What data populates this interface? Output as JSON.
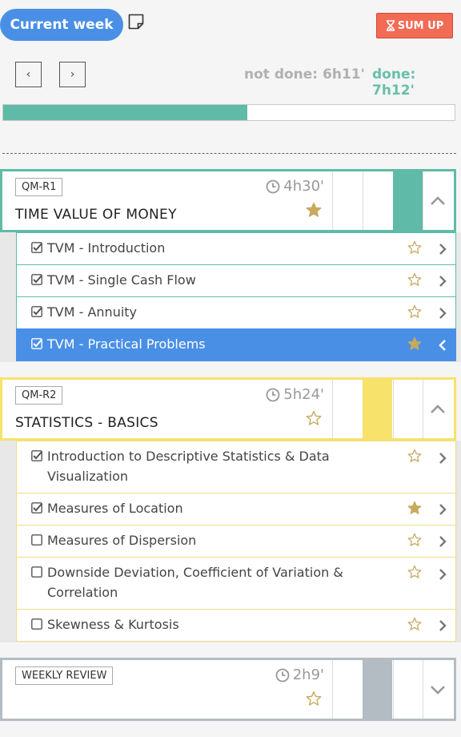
{
  "header": {
    "week_label": "Current week",
    "sum_up_label": "SUM UP",
    "prev_label": "‹",
    "next_label": "›",
    "not_done_label": "not done: 6h11'",
    "done_label": "done: 7h12'",
    "progress_fraction": 0.54
  },
  "colors": {
    "accent": "#4a8fe6",
    "done": "#68bfa8",
    "section1": "#5fbba7",
    "section2": "#f7e26b",
    "section3": "#b3bcc2",
    "sumup": "#f26b55"
  },
  "sections": [
    {
      "code": "QM-R1",
      "title": "TIME VALUE OF MONEY",
      "time": "4h30'",
      "starred": true,
      "expanded": true,
      "topics": [
        {
          "label": "TVM - Introduction",
          "checked": true,
          "starred": false,
          "active": false
        },
        {
          "label": "TVM - Single Cash Flow",
          "checked": true,
          "starred": false,
          "active": false
        },
        {
          "label": "TVM - Annuity",
          "checked": true,
          "starred": false,
          "active": false
        },
        {
          "label": "TVM - Practical Problems",
          "checked": true,
          "starred": true,
          "active": true
        }
      ]
    },
    {
      "code": "QM-R2",
      "title": "STATISTICS - BASICS",
      "time": "5h24'",
      "starred": false,
      "expanded": true,
      "topics": [
        {
          "label_line1": "Introduction to Descriptive Statistics & Data",
          "label_line2": "Visualization",
          "checked": true,
          "starred": false
        },
        {
          "label": "Measures of Location",
          "checked": true,
          "starred": true
        },
        {
          "label": "Measures of Dispersion",
          "checked": false,
          "starred": false
        },
        {
          "label_line1": "Downside Deviation, Coefficient of Variation &",
          "label_line2": "Correlation",
          "checked": false,
          "starred": false
        },
        {
          "label": "Skewness & Kurtosis",
          "checked": false,
          "starred": false
        }
      ]
    },
    {
      "code": "WEEKLY REVIEW",
      "title": "",
      "time": "2h9'",
      "starred": false,
      "expanded": false,
      "topics": []
    }
  ]
}
